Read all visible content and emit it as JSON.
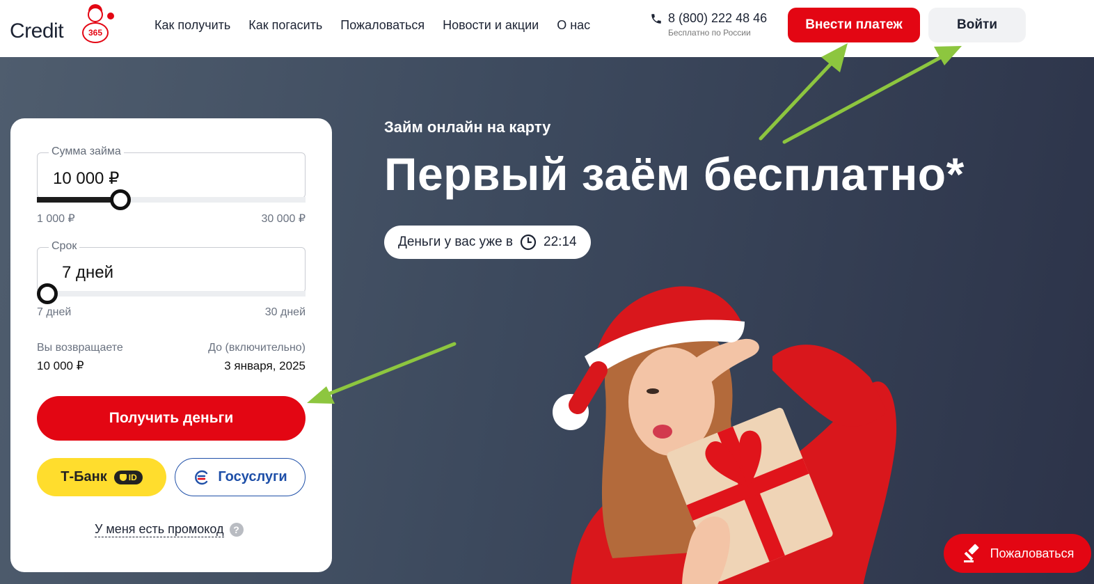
{
  "header": {
    "logo_text": "Credit",
    "logo_number": "365",
    "nav": [
      "Как получить",
      "Как погасить",
      "Пожаловаться",
      "Новости и акции",
      "О нас"
    ],
    "phone": "8 (800) 222 48 46",
    "phone_sub": "Бесплатно по России",
    "pay_button": "Внести платеж",
    "login_button": "Войти"
  },
  "calculator": {
    "amount": {
      "label": "Сумма займа",
      "value": "10 000 ₽",
      "min": "1 000 ₽",
      "max": "30 000 ₽",
      "fraction": 0.31
    },
    "term": {
      "label": "Срок",
      "value": "7 дней",
      "min": "7 дней",
      "max": "30 дней",
      "fraction": 0.0
    },
    "return_label": "Вы возвращаете",
    "return_value": "10 000 ₽",
    "until_label": "До (включительно)",
    "until_value": "3 января, 2025",
    "get_button": "Получить деньги",
    "tbank_button": "Т-Банк",
    "tbank_badge": "ID",
    "gosuslugi_button": "Госуслуги",
    "promo_link": "У меня есть промокод",
    "promo_help": "?"
  },
  "hero": {
    "subtitle": "Займ онлайн на карту",
    "title": "Первый заём бесплатно*",
    "pill_text": "Деньги у вас уже в",
    "pill_time": "22:14"
  },
  "complain_button": "Пожаловаться",
  "colors": {
    "brand_red": "#e30613",
    "hero_bg_start": "#4f5d6e",
    "hero_bg_end": "#2c3349",
    "tbank_yellow": "#ffdd2d",
    "gosuslugi_blue": "#1e4fa8",
    "arrow_green": "#8dc63f"
  }
}
